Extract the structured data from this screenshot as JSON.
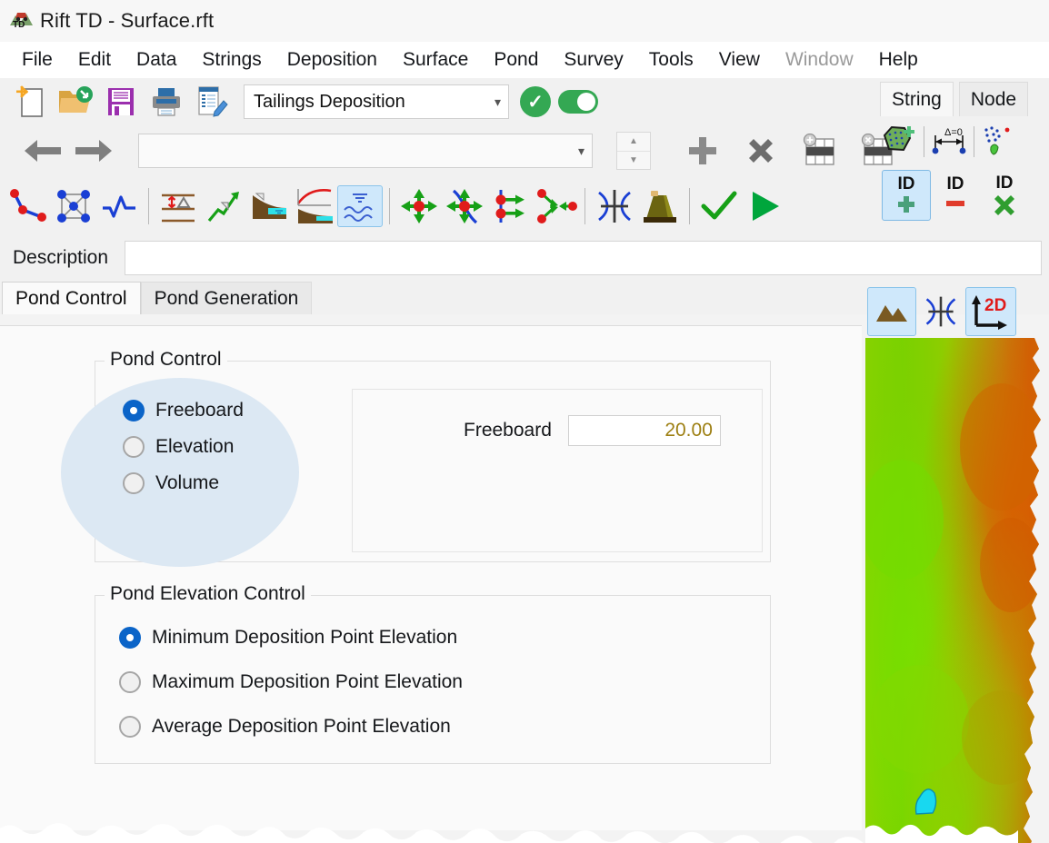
{
  "window": {
    "title": "Rift TD - Surface.rft",
    "logo_icon": "app-logo-icon"
  },
  "menu": {
    "items": [
      {
        "label": "File",
        "enabled": true
      },
      {
        "label": "Edit",
        "enabled": true
      },
      {
        "label": "Data",
        "enabled": true
      },
      {
        "label": "Strings",
        "enabled": true
      },
      {
        "label": "Deposition",
        "enabled": true
      },
      {
        "label": "Surface",
        "enabled": true
      },
      {
        "label": "Pond",
        "enabled": true
      },
      {
        "label": "Survey",
        "enabled": true
      },
      {
        "label": "Tools",
        "enabled": true
      },
      {
        "label": "View",
        "enabled": true
      },
      {
        "label": "Window",
        "enabled": false
      },
      {
        "label": "Help",
        "enabled": true
      }
    ]
  },
  "toolbar_file": {
    "buttons": [
      {
        "icon": "new-document-icon",
        "name": "new-button"
      },
      {
        "icon": "open-folder-icon",
        "name": "open-button"
      },
      {
        "icon": "save-floppy-icon",
        "name": "save-button"
      },
      {
        "icon": "printer-icon",
        "name": "print-button"
      },
      {
        "icon": "edit-report-icon",
        "name": "report-button"
      }
    ],
    "mode_select": {
      "value": "Tailings Deposition",
      "chevron": "chevron-down-icon"
    },
    "apply_icon": "check-circle-icon",
    "toggle": {
      "name": "enable-toggle",
      "on": true
    }
  },
  "toolbar_nav": {
    "back_icon": "arrow-left-icon",
    "forward_icon": "arrow-right-icon",
    "record_select": {
      "value": "",
      "placeholder": ""
    },
    "spinner": {
      "up": "triangle-up-icon",
      "down": "triangle-down-icon"
    },
    "add_icon": "plus-icon",
    "delete_icon": "cross-icon",
    "insert_row_icon": "table-insert-row-icon",
    "delete_row_icon": "table-delete-row-icon"
  },
  "toolbar_tools": {
    "buttons": [
      {
        "icon": "polyline-points-icon",
        "name": "string-tool"
      },
      {
        "icon": "mesh-network-icon",
        "name": "mesh-tool"
      },
      {
        "icon": "waveform-icon",
        "name": "profile-tool"
      },
      {
        "icon": "contour-delta-icon",
        "name": "contour-tool"
      },
      {
        "icon": "slope-arrow-icon",
        "name": "slope-tool"
      },
      {
        "icon": "beach-section-icon",
        "name": "beach-tool"
      },
      {
        "icon": "beach-curve-chart-icon",
        "name": "beach-curve-tool"
      },
      {
        "icon": "water-waves-icon",
        "name": "pond-tool",
        "selected": true
      },
      {
        "icon": "move-point-icon",
        "name": "move-point-tool"
      },
      {
        "icon": "move-curve-point-icon",
        "name": "move-curve-tool"
      },
      {
        "icon": "offset-points-icon",
        "name": "offset-points-tool"
      },
      {
        "icon": "branch-points-icon",
        "name": "branch-tool"
      },
      {
        "icon": "string-cross-icon",
        "name": "intersect-tool"
      },
      {
        "icon": "embankment-icon",
        "name": "embankment-tool"
      },
      {
        "icon": "check-mark-icon",
        "name": "accept-button"
      },
      {
        "icon": "play-triangle-icon",
        "name": "run-button"
      }
    ]
  },
  "description": {
    "label": "Description",
    "value": "",
    "placeholder": ""
  },
  "tabs": [
    {
      "label": "Pond Control",
      "active": true
    },
    {
      "label": "Pond Generation",
      "active": false
    }
  ],
  "pond_control": {
    "group_title": "Pond Control",
    "options": [
      {
        "label": "Freeboard",
        "selected": true
      },
      {
        "label": "Elevation",
        "selected": false
      },
      {
        "label": "Volume",
        "selected": false
      }
    ],
    "freeboard": {
      "label": "Freeboard",
      "value": "20.00"
    }
  },
  "pond_elevation_control": {
    "group_title": "Pond Elevation Control",
    "options": [
      {
        "label": "Minimum Deposition Point Elevation",
        "selected": true
      },
      {
        "label": "Maximum Deposition Point Elevation",
        "selected": false
      },
      {
        "label": "Average Deposition Point Elevation",
        "selected": false
      }
    ]
  },
  "right_dock": {
    "tabs": [
      {
        "label": "String",
        "active": true
      },
      {
        "label": "Node",
        "active": false
      }
    ],
    "tools_row1": [
      {
        "icon": "polygon-add-icon",
        "name": "add-polygon-tool"
      },
      {
        "icon": "delta-zero-measure-icon",
        "name": "measure-tool"
      },
      {
        "icon": "scatter-points-icon",
        "name": "scatter-tool"
      }
    ],
    "tools_row2": [
      {
        "icon": "id-plus-icon",
        "name": "id-add-button",
        "selected": true
      },
      {
        "icon": "id-minus-icon",
        "name": "id-remove-button",
        "selected": false
      },
      {
        "icon": "id-cross-icon",
        "name": "id-clear-button",
        "selected": false
      }
    ]
  },
  "viewport": {
    "buttons": [
      {
        "icon": "terrain-mountain-icon",
        "name": "view-terrain-button",
        "selected": true
      },
      {
        "icon": "string-cross-icon",
        "name": "view-strings-button",
        "selected": false
      },
      {
        "icon": "axis-2d-icon",
        "name": "view-2d-button",
        "selected": true
      }
    ],
    "label_2d": "2D",
    "map": {
      "name": "terrain-elevation-map",
      "pond_color": "#18d8f0",
      "low_color": "#66dd00",
      "high_color": "#d05a00"
    }
  },
  "colors": {
    "accent_blue": "#0b64c8",
    "selection_blue": "#cfe8fb",
    "green": "#34a853",
    "value_olive": "#9d7f12",
    "highlight_blob": "#dce8f3"
  }
}
